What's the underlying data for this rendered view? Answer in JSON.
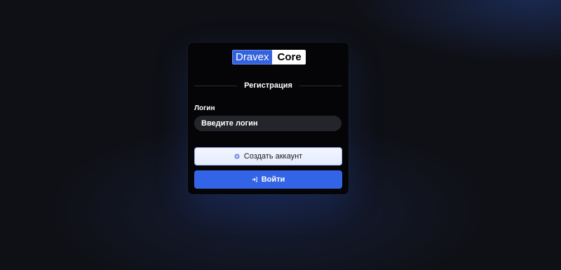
{
  "logo": {
    "left": "Dravex",
    "right": "Core",
    "accent_color": "#3461dd"
  },
  "form": {
    "section_title": "Регистрация",
    "login_label": "Логин",
    "login_placeholder": "Введите логин",
    "login_value": ""
  },
  "buttons": {
    "create_account": "Создать аккаунт",
    "create_icon": "plus-circle-icon",
    "login": "Войти",
    "login_icon": "sign-in-icon",
    "login_color": "#3363e6"
  }
}
